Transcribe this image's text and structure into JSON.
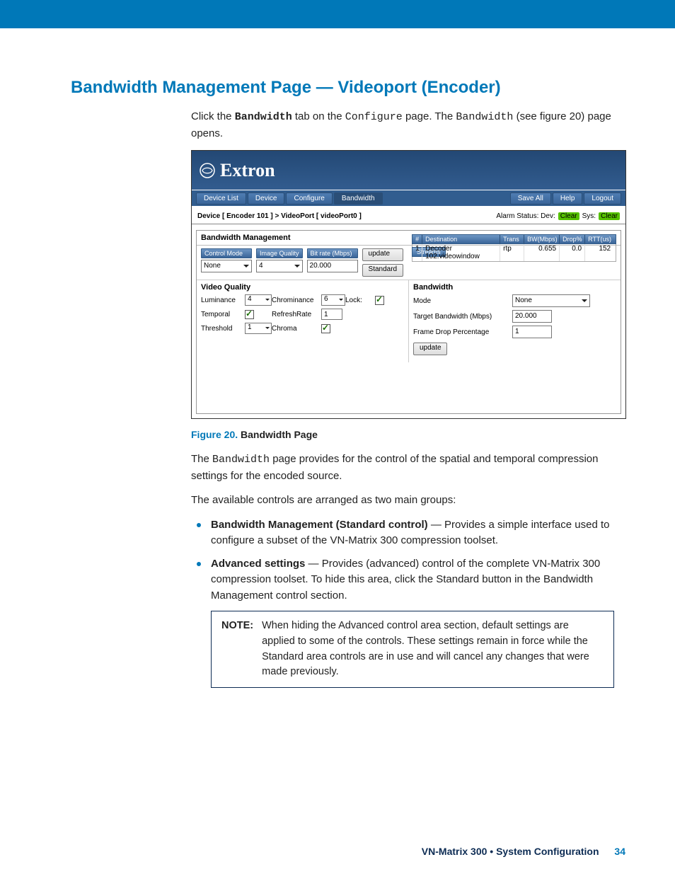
{
  "page_title": "Bandwidth Management Page — Videoport (Encoder)",
  "intro": {
    "p1a": "Click the ",
    "p1b": "Bandwidth",
    "p1c": " tab on the ",
    "p1d": "Configure",
    "p1e": " page. The ",
    "p1f": "Bandwidth",
    "p1g": " (see figure 20) page opens."
  },
  "screenshot": {
    "logo_text": "Extron",
    "tabs": {
      "t1": "Device List",
      "t2": "Device",
      "t3": "Configure",
      "t4": "Bandwidth"
    },
    "actions": {
      "a1": "Save All",
      "a2": "Help",
      "a3": "Logout"
    },
    "breadcrumb": "Device [ Encoder 101 ]  >  VideoPort [ videoPort0 ]",
    "alarm_prefix": "Alarm Status: Dev:",
    "alarm_clear": "Clear",
    "alarm_mid": "  Sys:",
    "section_title": "Bandwidth Management",
    "row1": {
      "ctrl_mode_label": "Control Mode",
      "ctrl_mode_value": "None",
      "iq_label": "Image Quality",
      "iq_value": "4",
      "bitrate_label": "Bit rate (Mbps)",
      "bitrate_value": "20.000",
      "update_btn": "update",
      "standard_btn": "Standard"
    },
    "streams": {
      "badge": "Streams",
      "hdr": {
        "h0": "#",
        "h1": "Destination",
        "h2": "Trans",
        "h3": "BW(Mbps)",
        "h4": "Drop%",
        "h5": "RTT(us)"
      },
      "row": {
        "c0": "1",
        "c1": "Decoder 102.videowindow",
        "c2": "rtp",
        "c3": "0.655",
        "c4": "0.0",
        "c5": "152"
      }
    },
    "vq": {
      "title": "Video Quality",
      "luminance_label": "Luminance",
      "luminance_val": "4",
      "chrominance_label": "Chrominance",
      "chrominance_val": "6",
      "lock_label": "Lock:",
      "temporal_label": "Temporal",
      "refresh_label": "RefreshRate",
      "refresh_val": "1",
      "threshold_label": "Threshold",
      "threshold_val": "1",
      "chroma_label": "Chroma"
    },
    "bw": {
      "title": "Bandwidth",
      "mode_label": "Mode",
      "mode_val": "None",
      "target_label": "Target Bandwidth (Mbps)",
      "target_val": "20.000",
      "drop_label": "Frame Drop Percentage",
      "drop_val": "1",
      "update_btn": "update"
    }
  },
  "figure": {
    "num": "Figure 20.",
    "title": " Bandwidth Page"
  },
  "desc": {
    "p1a": "The ",
    "p1b": "Bandwidth",
    "p1c": " page provides for the control of the spatial and temporal compression settings for the encoded source.",
    "p2": "The available controls are arranged as two main groups:"
  },
  "bullet1": {
    "strong": "Bandwidth Management (Standard control)",
    "rest": " — Provides a simple interface used to configure a subset of the VN-Matrix 300 compression toolset."
  },
  "bullet2": {
    "strong": "Advanced settings",
    "rest1": " — Provides (advanced) control of the complete VN-Matrix 300 compression toolset. To hide this area, click the ",
    "code": "Standard",
    "rest2": " button in the Bandwidth Management control section."
  },
  "note": {
    "label": "NOTE:",
    "text": "When hiding the Advanced control area section, default settings are applied to some of the controls. These settings remain in force while the Standard area controls are in use and will cancel any changes that were made previously."
  },
  "footer": {
    "title": "VN-Matrix 300 • System Configuration",
    "page": "34"
  }
}
